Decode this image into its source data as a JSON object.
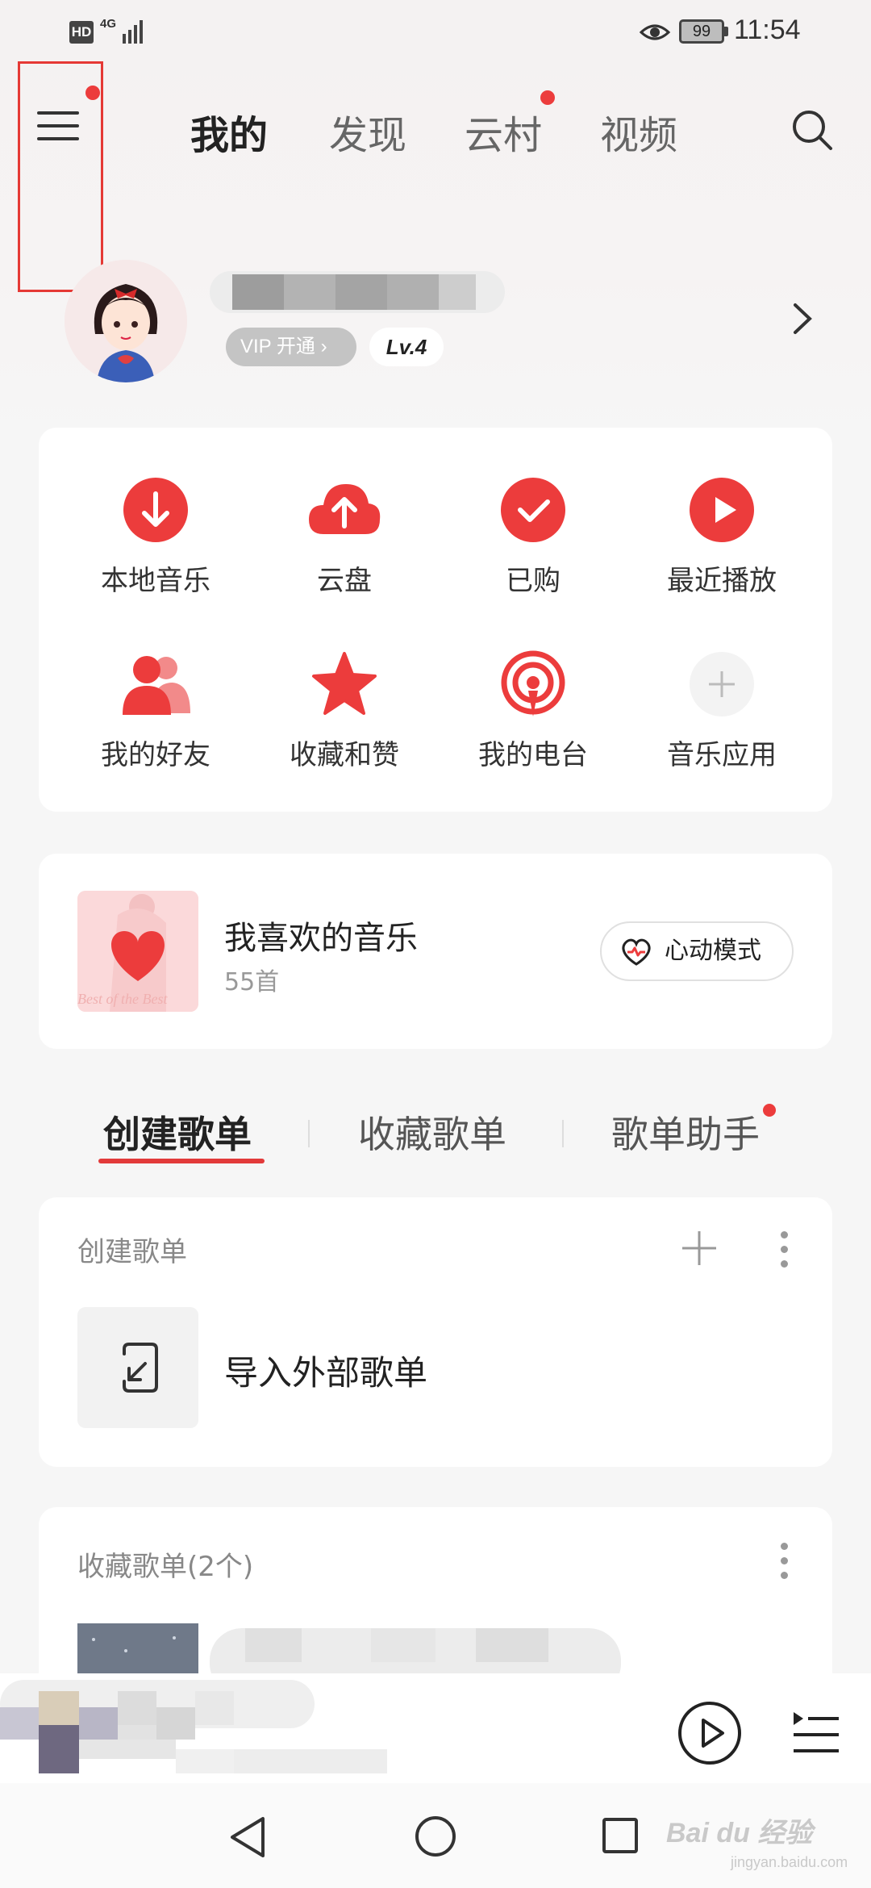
{
  "status_bar": {
    "hd": "HD",
    "network": "4G",
    "battery": "99",
    "time": "11:54"
  },
  "header": {
    "tabs": [
      {
        "label": "我的",
        "active": true,
        "dot": false
      },
      {
        "label": "发现",
        "active": false,
        "dot": false
      },
      {
        "label": "云村",
        "active": false,
        "dot": true
      },
      {
        "label": "视频",
        "active": false,
        "dot": false
      }
    ],
    "menu_icon": "menu-icon",
    "search_icon": "search-icon"
  },
  "profile": {
    "vip_label": "VIP 开通",
    "level": "Lv.4"
  },
  "quick_actions": [
    {
      "label": "本地音乐",
      "icon": "download-icon"
    },
    {
      "label": "云盘",
      "icon": "cloud-upload-icon"
    },
    {
      "label": "已购",
      "icon": "check-icon"
    },
    {
      "label": "最近播放",
      "icon": "play-icon"
    },
    {
      "label": "我的好友",
      "icon": "friends-icon"
    },
    {
      "label": "收藏和赞",
      "icon": "star-icon"
    },
    {
      "label": "我的电台",
      "icon": "radio-icon"
    },
    {
      "label": "音乐应用",
      "icon": "plus-icon"
    }
  ],
  "liked_music": {
    "title": "我喜欢的音乐",
    "count": "55首",
    "mode_button": "心动模式",
    "cover_text": "Best of the Best"
  },
  "playlist_tabs": [
    {
      "label": "创建歌单",
      "active": true,
      "dot": false
    },
    {
      "label": "收藏歌单",
      "active": false,
      "dot": false
    },
    {
      "label": "歌单助手",
      "active": false,
      "dot": true
    }
  ],
  "created_section": {
    "title": "创建歌单",
    "import_label": "导入外部歌单"
  },
  "favorite_section": {
    "title": "收藏歌单(2个)"
  },
  "watermark": {
    "text": "Bai du 经验",
    "sub": "jingyan.baidu.com"
  },
  "colors": {
    "accent": "#ec3c3c",
    "background": "#f6f6f6"
  }
}
